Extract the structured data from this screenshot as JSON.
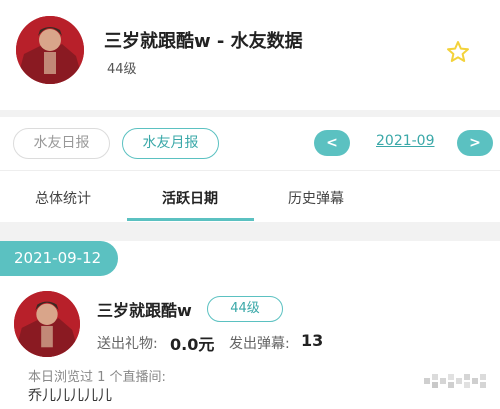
{
  "profile": {
    "title": "三岁就跟酷w - 水友数据",
    "level": "44级",
    "favorite_icon": "star-icon"
  },
  "filters": {
    "daily_label": "水友日报",
    "monthly_label": "水友月报",
    "prev_label": "<",
    "next_label": ">",
    "month": "2021-09"
  },
  "tabs": [
    "总体统计",
    "活跃日期",
    "历史弹幕"
  ],
  "active_tab": "活跃日期",
  "day": {
    "date": "2021-09-12",
    "name": "三岁就跟酷w",
    "level": "44级",
    "gift_label": "送出礼物:",
    "gift_value": "0.0元",
    "danmu_label": "发出弹幕:",
    "danmu_value": "13",
    "visited_text": "本日浏览过 1 个直播间:",
    "room_name": "乔儿儿儿儿儿"
  },
  "colors": {
    "accent": "#5bc1c1",
    "star": "#f3d23a",
    "avatar_red": "#b8202a"
  }
}
